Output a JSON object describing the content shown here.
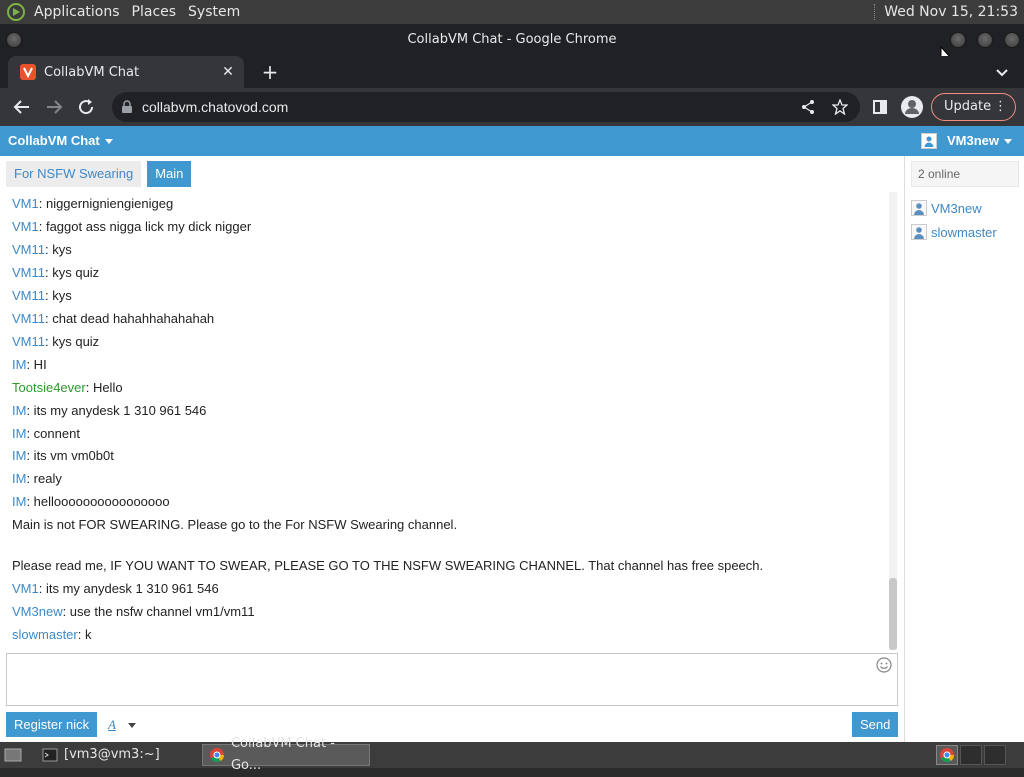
{
  "top_panel": {
    "menus": [
      "Applications",
      "Places",
      "System"
    ],
    "clock": "Wed Nov 15, 21:53"
  },
  "window": {
    "title": "CollabVM Chat - Google Chrome"
  },
  "tab": {
    "title": "CollabVM Chat"
  },
  "omnibox": {
    "url": "collabvm.chatovod.com"
  },
  "toolbar": {
    "update_label": "Update"
  },
  "app": {
    "title": "CollabVM Chat",
    "current_user": "VM3new"
  },
  "channels": [
    {
      "label": "For NSFW Swearing",
      "active": false
    },
    {
      "label": "Main",
      "active": true
    }
  ],
  "messages": [
    {
      "nick": "VM1",
      "text": ": niggernigniengienigeg"
    },
    {
      "nick": "VM1",
      "text": ": faggot ass nigga lick my dick nigger"
    },
    {
      "nick": "VM11",
      "text": ": kys"
    },
    {
      "nick": "VM11",
      "text": ": kys quiz"
    },
    {
      "nick": "VM11",
      "text": ": kys"
    },
    {
      "nick": "VM11",
      "text": ": chat dead hahahhahahahah"
    },
    {
      "nick": "VM11",
      "text": ": kys quiz"
    },
    {
      "nick": "IM",
      "text": ": HI"
    },
    {
      "nick": "Tootsie4ever",
      "text": ": Hello"
    },
    {
      "nick": "IM",
      "text": ": its my anydesk 1 310 961 546"
    },
    {
      "nick": "IM",
      "text": ": connent"
    },
    {
      "nick": "IM",
      "text": ": its vm vm0b0t"
    },
    {
      "nick": "IM",
      "text": ": realy"
    },
    {
      "nick": "IM",
      "text": ": helloooooooooooooooo"
    },
    {
      "nick": "",
      "text": "Main is not FOR SWEARING. Please go to the For NSFW Swearing channel."
    },
    {
      "nick": "",
      "text": "Please read me, IF YOU WANT TO SWEAR, PLEASE GO TO THE NSFW SWEARING CHANNEL. That channel has free speech."
    },
    {
      "nick": "VM1",
      "text": ": its my anydesk 1 310 961 546"
    },
    {
      "nick": "VM3new",
      "text": ": use the nsfw channel vm1/vm11"
    },
    {
      "nick": "slowmaster",
      "text": ": k"
    }
  ],
  "compose": {
    "value": ""
  },
  "buttons": {
    "register": "Register nick",
    "format": "A",
    "send": "Send"
  },
  "sidebar": {
    "online": "2 online",
    "users": [
      "VM3new",
      "slowmaster"
    ]
  },
  "taskbar": {
    "tasks": [
      "[vm3@vm3:~]",
      "CollabVM Chat - Go..."
    ]
  },
  "colors": {
    "accent": "#3f98cf",
    "nick": "#3f88c5",
    "nick_green": "#2e9b2e"
  }
}
